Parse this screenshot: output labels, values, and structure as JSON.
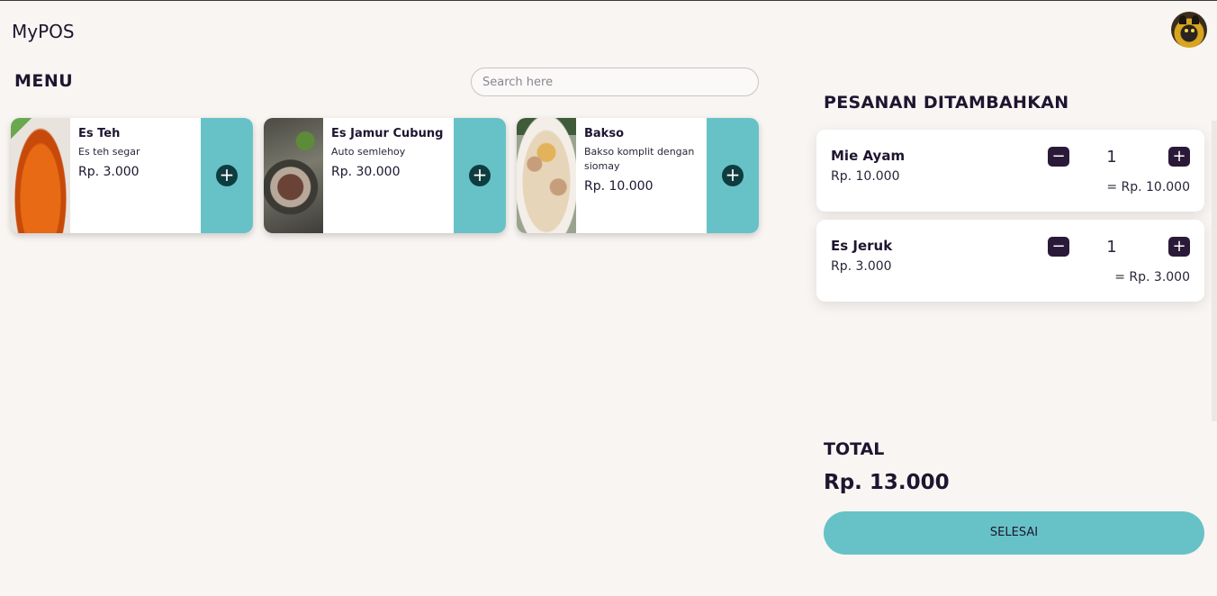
{
  "app": {
    "title": "MyPOS"
  },
  "menu": {
    "title": "MENU",
    "search_placeholder": "Search here",
    "items": [
      {
        "name": "Es Teh",
        "description": "Es teh segar",
        "price": "Rp. 3.000",
        "add_icon": "+"
      },
      {
        "name": "Es Jamur Cubung",
        "description": "Auto semlehoy",
        "price": "Rp. 30.000",
        "add_icon": "+"
      },
      {
        "name": "Bakso",
        "description": "Bakso komplit dengan siomay",
        "price": "Rp. 10.000",
        "add_icon": "+"
      }
    ]
  },
  "orders": {
    "title": "PESANAN DITAMBAHKAN",
    "items": [
      {
        "name": "Mie Ayam",
        "price": "Rp. 10.000",
        "quantity": "1",
        "subtotal": "= Rp. 10.000",
        "minus": "−",
        "plus": "+"
      },
      {
        "name": "Es Jeruk",
        "price": "Rp. 3.000",
        "quantity": "1",
        "subtotal": "= Rp. 3.000",
        "minus": "−",
        "plus": "+"
      }
    ]
  },
  "summary": {
    "total_label": "TOTAL",
    "total_value": "Rp. 13.000",
    "done_label": "SELESAI"
  },
  "colors": {
    "accent": "#67c2c7",
    "dark": "#2a1a38",
    "background": "#f9f5f2"
  }
}
